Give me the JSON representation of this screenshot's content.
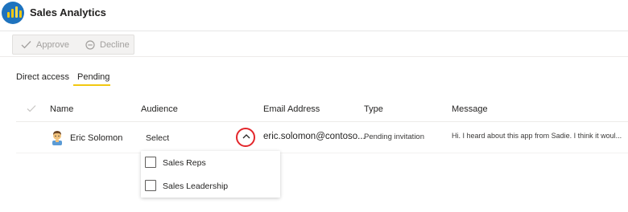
{
  "app": {
    "title": "Sales Analytics",
    "logo_icon": "bar-chart-logo",
    "accent": "#f2c811",
    "brand_blue": "#1e73be"
  },
  "toolbar": {
    "approve_label": "Approve",
    "decline_label": "Decline"
  },
  "tabs": [
    {
      "label": "Direct access",
      "active": false
    },
    {
      "label": "Pending",
      "active": true
    }
  ],
  "table": {
    "columns": [
      "Name",
      "Audience",
      "Email Address",
      "Type",
      "Message"
    ],
    "rows": [
      {
        "name": "Eric Solomon",
        "audience": "Select",
        "email": "eric.solomon@contoso...",
        "type": "Pending invitation",
        "message": "Hi. I heard about this app from Sadie. I think it woul..."
      }
    ]
  },
  "audience_dropdown": {
    "open": true,
    "highlight_color": "#e3262b",
    "options": [
      {
        "label": "Sales Reps",
        "checked": false
      },
      {
        "label": "Sales Leadership",
        "checked": false
      }
    ]
  }
}
